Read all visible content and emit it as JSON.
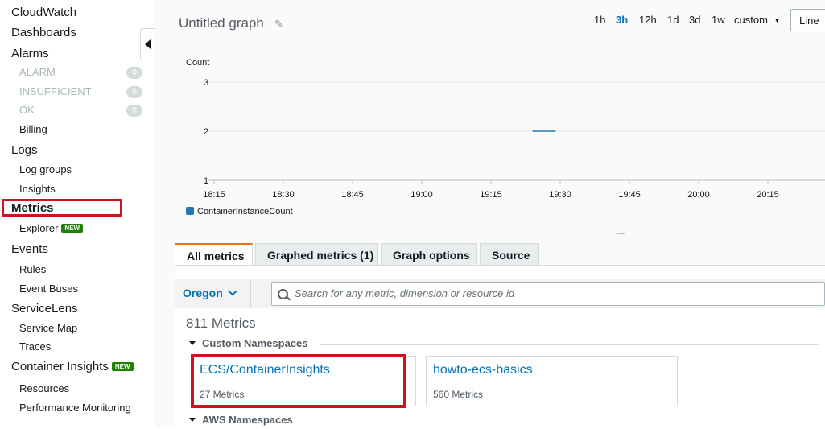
{
  "sidebar": {
    "items": [
      {
        "label": "CloudWatch"
      },
      {
        "label": "Dashboards"
      },
      {
        "label": "Alarms"
      },
      {
        "label": "ALARM",
        "count": "0"
      },
      {
        "label": "INSUFFICIENT",
        "count": "0"
      },
      {
        "label": "OK",
        "count": "0"
      },
      {
        "label": "Billing"
      },
      {
        "label": "Logs"
      },
      {
        "label": "Log groups"
      },
      {
        "label": "Insights"
      },
      {
        "label": "Metrics"
      },
      {
        "label": "Explorer",
        "badge": "NEW"
      },
      {
        "label": "Events"
      },
      {
        "label": "Rules"
      },
      {
        "label": "Event Buses"
      },
      {
        "label": "ServiceLens"
      },
      {
        "label": "Service Map"
      },
      {
        "label": "Traces"
      },
      {
        "label": "Container Insights",
        "badge": "NEW"
      },
      {
        "label": "Resources"
      },
      {
        "label": "Performance Monitoring"
      }
    ]
  },
  "graph": {
    "title": "Untitled graph",
    "time_ranges": [
      "1h",
      "3h",
      "12h",
      "1d",
      "3d",
      "1w"
    ],
    "selected_range": "3h",
    "custom_label": "custom",
    "view_type": "Line",
    "resize_handle": "---"
  },
  "chart_data": {
    "type": "line",
    "ylabel": "Count",
    "yticks": [
      "1",
      "2",
      "3"
    ],
    "ylim": [
      1,
      3
    ],
    "x_ticks": [
      "18:15",
      "18:30",
      "18:45",
      "19:00",
      "19:15",
      "19:30",
      "19:45",
      "20:00",
      "20:15"
    ],
    "grid": true,
    "legend_position": "bottom-left",
    "series": [
      {
        "name": "ContainerInstanceCount",
        "color": "#1f77b4",
        "x": [
          "19:24",
          "19:29"
        ],
        "values": [
          2,
          2
        ]
      }
    ]
  },
  "tabs": [
    {
      "label": "All metrics",
      "active": true
    },
    {
      "label": "Graphed metrics (1)",
      "active": false
    },
    {
      "label": "Graph options",
      "active": false
    },
    {
      "label": "Source",
      "active": false
    }
  ],
  "browser": {
    "region": "Oregon",
    "search_placeholder": "Search for any metric, dimension or resource id",
    "metric_count": "811 Metrics",
    "custom_namespaces_label": "Custom Namespaces",
    "namespaces": [
      {
        "name": "ECS/ContainerInsights",
        "count": "27 Metrics"
      },
      {
        "name": "howto-ecs-basics",
        "count": "560 Metrics"
      }
    ],
    "aws_namespaces_label": "AWS Namespaces"
  },
  "colors": {
    "highlight": "#d0121f",
    "link": "#0073bb",
    "active_tab_accent": "#ec7211",
    "new_badge": "#1d8102"
  },
  "icons": [
    "pencil-icon",
    "search-icon",
    "chevron-down-icon",
    "collapse-arrow-icon",
    "caret-down-icon"
  ]
}
